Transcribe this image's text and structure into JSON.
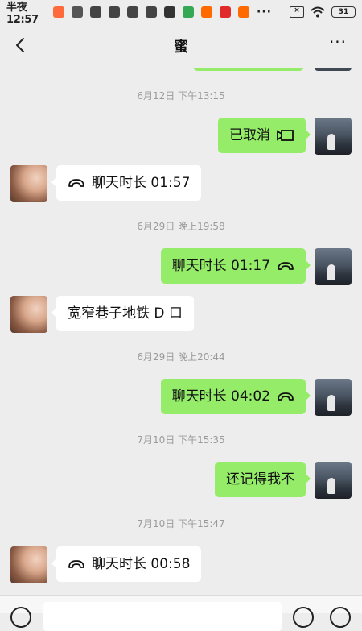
{
  "status_bar": {
    "time": "半夜12:57",
    "battery": "31",
    "overflow": "···",
    "icons": [
      {
        "name": "app-orange-icon",
        "color": "#ff6a3d"
      },
      {
        "name": "calendar-icon",
        "color": "#555555"
      },
      {
        "name": "notification-cat-icon",
        "color": "#444444"
      },
      {
        "name": "notification-cat-icon",
        "color": "#444444"
      },
      {
        "name": "notification-cat-icon",
        "color": "#444444"
      },
      {
        "name": "notification-cat-icon",
        "color": "#444444"
      },
      {
        "name": "check-icon",
        "color": "#333333"
      },
      {
        "name": "play-store-icon",
        "color": "#34a853"
      },
      {
        "name": "mi-app-icon",
        "color": "#ff6a00"
      },
      {
        "name": "netease-music-icon",
        "color": "#e22a2a"
      },
      {
        "name": "mi-app-icon",
        "color": "#ff6a00"
      }
    ]
  },
  "header": {
    "title": "蜜",
    "more_label": "···"
  },
  "colors": {
    "outgoing_bubble": "#95ec69",
    "incoming_bubble": "#ffffff",
    "background": "#ededed",
    "timestamp": "#9a9a9a"
  },
  "messages": [
    {
      "type": "timestamp",
      "text": "6月12日 下午13:15"
    },
    {
      "type": "message",
      "direction": "out",
      "text": "已取消",
      "icon": "cancelled-video-call-icon"
    },
    {
      "type": "message",
      "direction": "in",
      "text": "聊天时长 01:57",
      "icon": "voice-call-icon"
    },
    {
      "type": "timestamp",
      "text": "6月29日 晚上19:58"
    },
    {
      "type": "message",
      "direction": "out",
      "text": "聊天时长 01:17",
      "icon": "voice-call-icon"
    },
    {
      "type": "message",
      "direction": "in",
      "text": "宽窄巷子地铁 D 口"
    },
    {
      "type": "timestamp",
      "text": "6月29日 晚上20:44"
    },
    {
      "type": "message",
      "direction": "out",
      "text": "聊天时长 04:02",
      "icon": "voice-call-icon"
    },
    {
      "type": "timestamp",
      "text": "7月10日 下午15:35"
    },
    {
      "type": "message",
      "direction": "out",
      "text": "还记得我不"
    },
    {
      "type": "timestamp",
      "text": "7月10日 下午15:47"
    },
    {
      "type": "message",
      "direction": "in",
      "text": "聊天时长 00:58",
      "icon": "voice-call-icon"
    }
  ]
}
